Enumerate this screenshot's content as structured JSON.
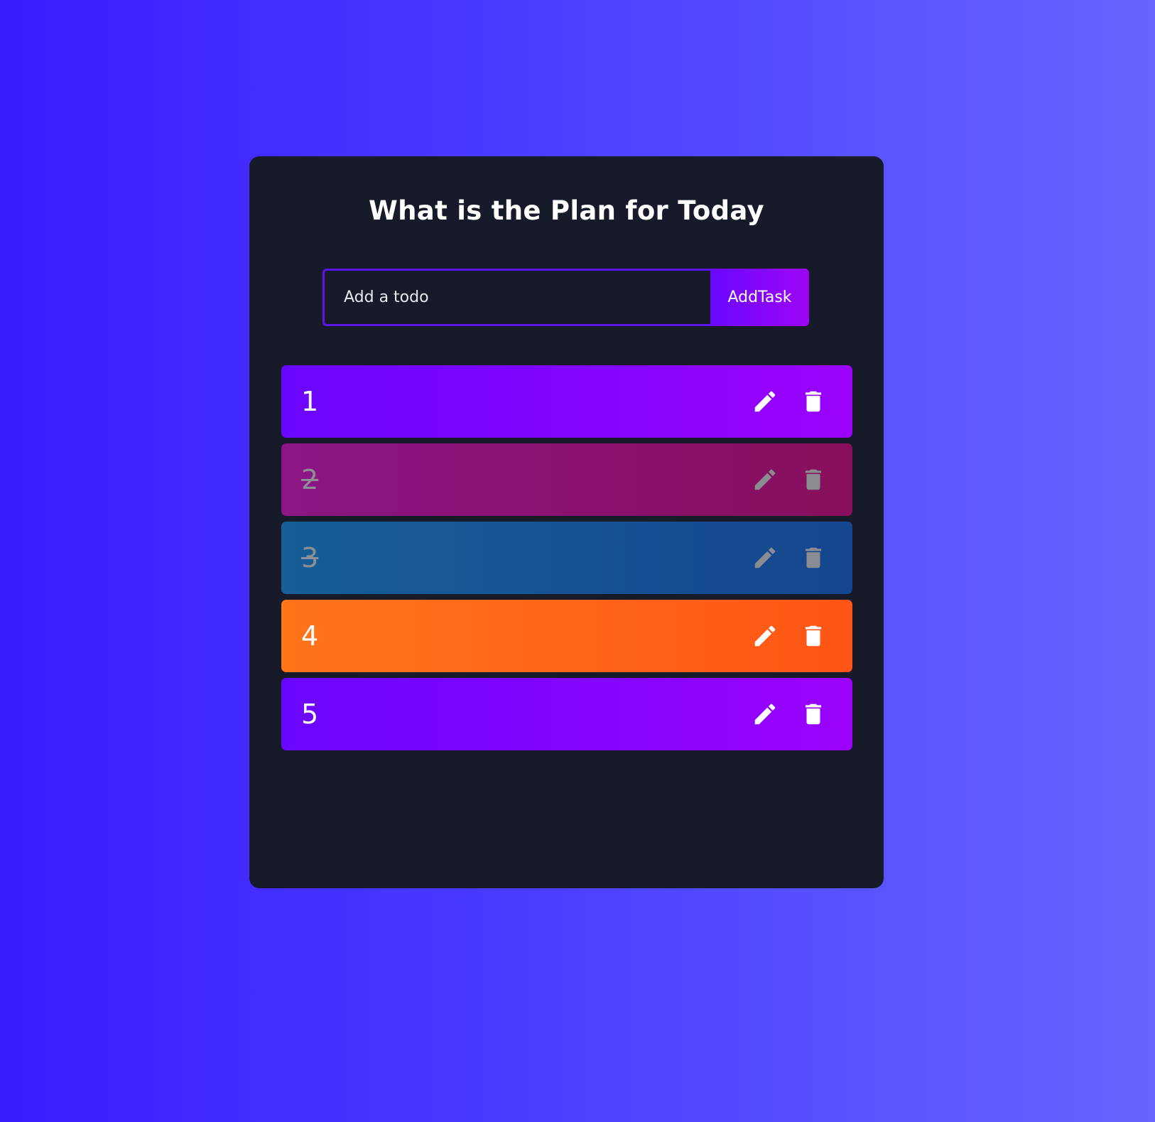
{
  "app": {
    "title": "What is the Plan for Today"
  },
  "form": {
    "placeholder": "Add a todo",
    "value": "",
    "button_label": "AddTask"
  },
  "todos": [
    {
      "text": "1",
      "complete": false,
      "gradient": [
        "#6a06ff",
        "#9a02fb"
      ]
    },
    {
      "text": "2",
      "complete": true,
      "gradient": [
        "#8b1685",
        "#870f5c"
      ]
    },
    {
      "text": "3",
      "complete": true,
      "gradient": [
        "#165e96",
        "#15468f"
      ]
    },
    {
      "text": "4",
      "complete": false,
      "gradient": [
        "#ff751a",
        "#ff5516"
      ]
    },
    {
      "text": "5",
      "complete": false,
      "gradient": [
        "#6a06ff",
        "#9a02fb"
      ]
    }
  ],
  "icons": {
    "edit": "pencil-icon",
    "delete": "trash-icon"
  }
}
